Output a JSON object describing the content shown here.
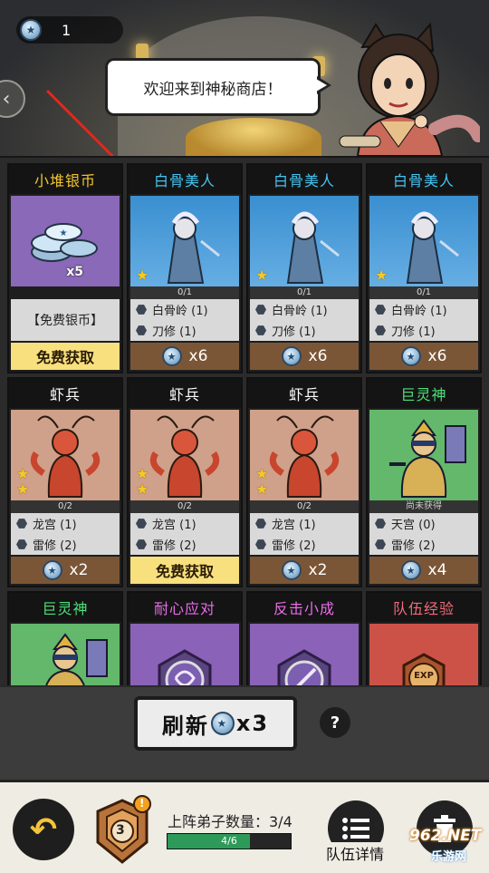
{
  "header": {
    "currency_value": "1",
    "welcome_text": "欢迎来到神秘商店！"
  },
  "cards": [
    {
      "title": "小堆银币",
      "title_color": "yellow",
      "bg": "purple",
      "note": "【免费银币】",
      "qty": "x5",
      "action": "免费获取"
    },
    {
      "title": "白骨美人",
      "title_color": "cyan",
      "bg": "blue",
      "progress": "0/1",
      "stars": 1,
      "tags": [
        "白骨岭 (1)",
        "刀修 (1)"
      ],
      "price": "x6"
    },
    {
      "title": "白骨美人",
      "title_color": "cyan",
      "bg": "blue",
      "progress": "0/1",
      "stars": 1,
      "tags": [
        "白骨岭 (1)",
        "刀修 (1)"
      ],
      "price": "x6"
    },
    {
      "title": "白骨美人",
      "title_color": "cyan",
      "bg": "blue",
      "progress": "0/1",
      "stars": 1,
      "tags": [
        "白骨岭 (1)",
        "刀修 (1)"
      ],
      "price": "x6"
    },
    {
      "title": "虾兵",
      "title_color": "white",
      "bg": "tan",
      "progress": "0/2",
      "stars": 2,
      "tags": [
        "龙宫 (1)",
        "雷修 (2)"
      ],
      "price": "x2"
    },
    {
      "title": "虾兵",
      "title_color": "white",
      "bg": "tan",
      "progress": "0/2",
      "stars": 2,
      "tags": [
        "龙宫 (1)",
        "雷修 (2)"
      ],
      "action": "免费获取"
    },
    {
      "title": "虾兵",
      "title_color": "white",
      "bg": "tan",
      "progress": "0/2",
      "stars": 2,
      "tags": [
        "龙宫 (1)",
        "雷修 (2)"
      ],
      "price": "x2"
    },
    {
      "title": "巨灵神",
      "title_color": "green",
      "bg": "green",
      "progress": "尚未获得",
      "stars": 0,
      "tags": [
        "天宫 (0)",
        "雷修 (2)"
      ],
      "price": "x4"
    },
    {
      "title": "巨灵神",
      "title_color": "green",
      "bg": "green"
    },
    {
      "title": "耐心应对",
      "title_color": "magenta",
      "bg": "violet"
    },
    {
      "title": "反击小成",
      "title_color": "magenta",
      "bg": "violet"
    },
    {
      "title": "队伍经验",
      "title_color": "pink",
      "bg": "red",
      "icon_text": "EXP"
    }
  ],
  "refresh": {
    "label": "刷新",
    "cost": "x3",
    "help": "?"
  },
  "bottom": {
    "level_badge": "3",
    "badge_alert": "!",
    "team_label": "上阵弟子数量：3/4",
    "team_progress_text": "4/6",
    "team_progress_fraction": 0.667,
    "team_detail_label": "队伍详情",
    "watermark": "962.NET",
    "watermark_sub": "乐游网"
  },
  "colors": {
    "yellow": "#f2c530",
    "cyan": "#46c4f2",
    "green": "#4de07a",
    "magenta": "#e86de8",
    "pink": "#f26a7a",
    "price_bar": "#7b5636",
    "free_button": "#f7e07d"
  }
}
